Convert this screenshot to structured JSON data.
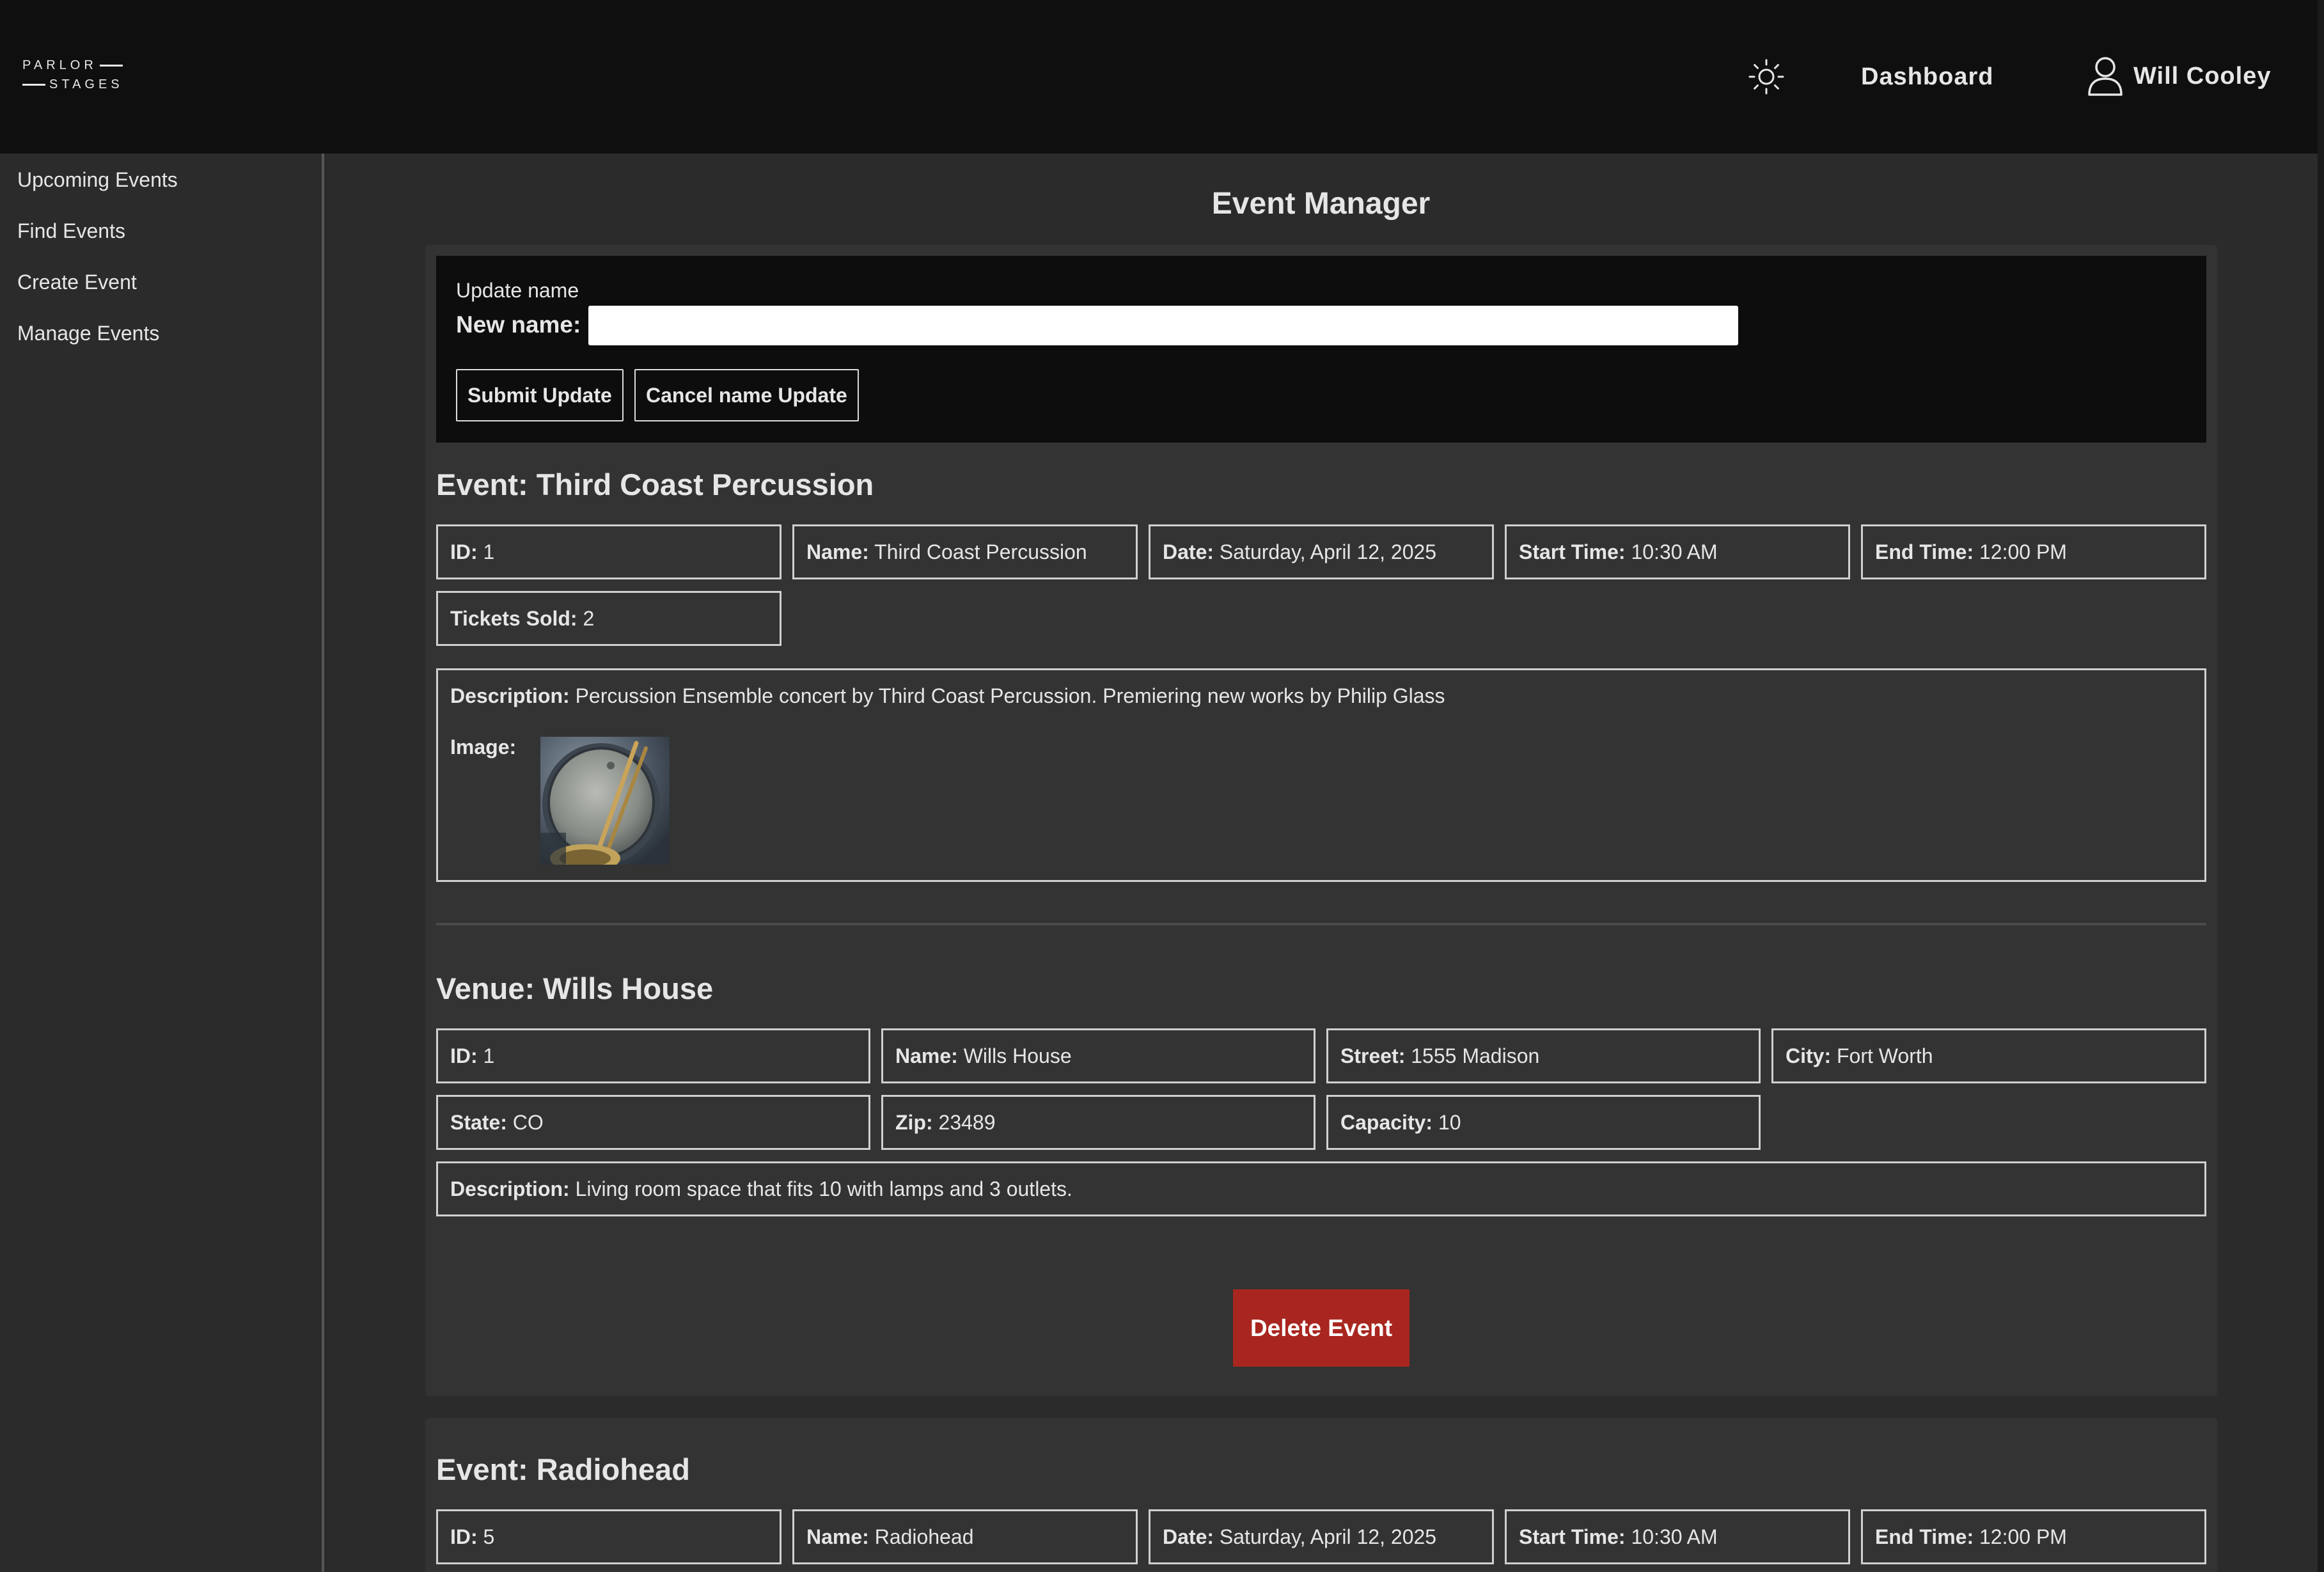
{
  "brand": {
    "line1": "PARLOR",
    "line2": "STAGES"
  },
  "header": {
    "theme_icon": "sun-icon",
    "dashboard_label": "Dashboard",
    "user_icon": "user-icon",
    "user_name": "Will Cooley"
  },
  "sidebar": {
    "items": [
      {
        "label": "Upcoming Events"
      },
      {
        "label": "Find Events"
      },
      {
        "label": "Create Event"
      },
      {
        "label": "Manage Events"
      }
    ]
  },
  "page": {
    "title": "Event Manager"
  },
  "update_form": {
    "heading": "Update name",
    "field_label": "New name:",
    "input_value": "",
    "submit_label": "Submit Update",
    "cancel_label": "Cancel name Update"
  },
  "events": [
    {
      "heading": "Event: Third Coast Percussion",
      "fields": [
        {
          "label": "ID:",
          "value": "1"
        },
        {
          "label": "Name:",
          "value": "Third Coast Percussion"
        },
        {
          "label": "Date:",
          "value": "Saturday, April 12, 2025"
        },
        {
          "label": "Start Time:",
          "value": "10:30 AM"
        },
        {
          "label": "End Time:",
          "value": "12:00 PM"
        },
        {
          "label": "Tickets Sold:",
          "value": "2"
        }
      ],
      "description_label": "Description:",
      "description": "Percussion Ensemble concert by Third Coast Percussion. Premiering new works by Philip Glass",
      "image_label": "Image:",
      "venue": {
        "heading": "Venue: Wills House",
        "fields": [
          {
            "label": "ID:",
            "value": "1"
          },
          {
            "label": "Name:",
            "value": "Wills House"
          },
          {
            "label": "Street:",
            "value": "1555 Madison"
          },
          {
            "label": "City:",
            "value": "Fort Worth"
          },
          {
            "label": "State:",
            "value": "CO"
          },
          {
            "label": "Zip:",
            "value": "23489"
          },
          {
            "label": "Capacity:",
            "value": "10"
          }
        ],
        "description_label": "Description:",
        "description": "Living room space that fits 10 with lamps and 3 outlets."
      },
      "delete_label": "Delete Event"
    },
    {
      "heading": "Event: Radiohead",
      "fields": [
        {
          "label": "ID:",
          "value": "5"
        },
        {
          "label": "Name:",
          "value": "Radiohead"
        },
        {
          "label": "Date:",
          "value": "Saturday, April 12, 2025"
        },
        {
          "label": "Start Time:",
          "value": "10:30 AM"
        },
        {
          "label": "End Time:",
          "value": "12:00 PM"
        }
      ]
    }
  ],
  "colors": {
    "topbar": "#0f0f0f",
    "background": "#2b2b2b",
    "card": "#333333",
    "delete_button": "#a8261f",
    "text": "#e6e6e6"
  }
}
